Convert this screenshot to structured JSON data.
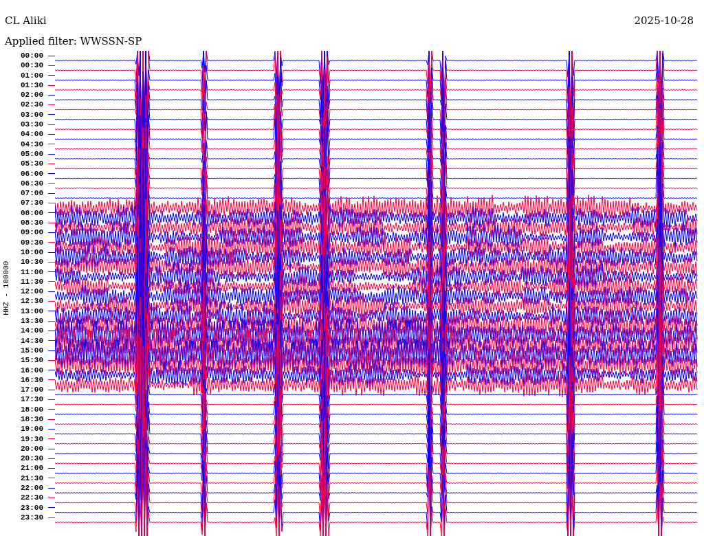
{
  "header": {
    "station": "CL Aliki",
    "date": "2025-10-28",
    "filter": "Applied filter: WWSSN-SP"
  },
  "axis_label": "HHZ - 100000",
  "rows": [
    {
      "time": "00:00",
      "color": "#0000ff"
    },
    {
      "time": "00:30",
      "color": "#ff0040"
    },
    {
      "time": "01:00",
      "color": "#0000ff"
    },
    {
      "time": "01:30",
      "color": "#ff0040"
    },
    {
      "time": "02:00",
      "color": "#0000ff"
    },
    {
      "time": "02:30",
      "color": "#ff0040"
    },
    {
      "time": "03:00",
      "color": "#0000ff"
    },
    {
      "time": "03:30",
      "color": "#ff0040"
    },
    {
      "time": "04:00",
      "color": "#0000ff"
    },
    {
      "time": "04:30",
      "color": "#ff0040"
    },
    {
      "time": "05:00",
      "color": "#0000ff"
    },
    {
      "time": "05:30",
      "color": "#ff0040"
    },
    {
      "time": "06:00",
      "color": "#0000ff"
    },
    {
      "time": "06:30",
      "color": "#ff0040"
    },
    {
      "time": "07:00",
      "color": "#0000ff"
    },
    {
      "time": "07:30",
      "color": "#ff0040"
    },
    {
      "time": "08:00",
      "color": "#0000ff"
    },
    {
      "time": "08:30",
      "color": "#ff0040"
    },
    {
      "time": "09:00",
      "color": "#0000ff"
    },
    {
      "time": "09:30",
      "color": "#ff0040"
    },
    {
      "time": "10:00",
      "color": "#0000ff"
    },
    {
      "time": "10:30",
      "color": "#ff0040"
    },
    {
      "time": "11:00",
      "color": "#0000ff"
    },
    {
      "time": "11:30",
      "color": "#ff0040"
    },
    {
      "time": "12:00",
      "color": "#0000ff"
    },
    {
      "time": "12:30",
      "color": "#ff0040"
    },
    {
      "time": "13:00",
      "color": "#0000ff"
    },
    {
      "time": "13:30",
      "color": "#ff0040"
    },
    {
      "time": "14:00",
      "color": "#0000ff"
    },
    {
      "time": "14:30",
      "color": "#ff0040"
    },
    {
      "time": "15:00",
      "color": "#0000ff"
    },
    {
      "time": "15:30",
      "color": "#ff0040"
    },
    {
      "time": "16:00",
      "color": "#0000ff"
    },
    {
      "time": "16:30",
      "color": "#ff0040"
    },
    {
      "time": "17:00",
      "color": "#0000ff"
    },
    {
      "time": "17:30",
      "color": "#ff0040"
    },
    {
      "time": "18:00",
      "color": "#0000ff"
    },
    {
      "time": "18:30",
      "color": "#ff0040"
    },
    {
      "time": "19:00",
      "color": "#0000ff"
    },
    {
      "time": "19:30",
      "color": "#ff0040"
    },
    {
      "time": "20:00",
      "color": "#0000ff"
    },
    {
      "time": "20:30",
      "color": "#ff0040"
    },
    {
      "time": "21:00",
      "color": "#0000ff"
    },
    {
      "time": "21:30",
      "color": "#ff0040"
    },
    {
      "time": "22:00",
      "color": "#0000ff"
    },
    {
      "time": "22:30",
      "color": "#ff0040"
    },
    {
      "time": "23:00",
      "color": "#0000ff"
    },
    {
      "time": "23:30",
      "color": "#ff0040"
    }
  ]
}
